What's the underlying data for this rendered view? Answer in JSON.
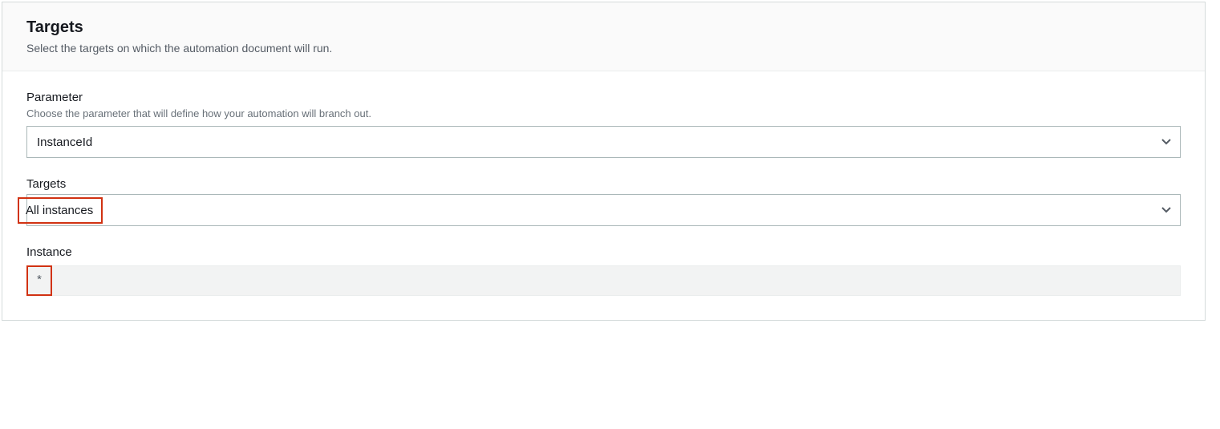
{
  "panel": {
    "title": "Targets",
    "subtitle": "Select the targets on which the automation document will run."
  },
  "parameter": {
    "label": "Parameter",
    "hint": "Choose the parameter that will define how your automation will branch out.",
    "value": "InstanceId"
  },
  "targets": {
    "label": "Targets",
    "value": "All instances"
  },
  "instance": {
    "label": "Instance",
    "value": "*"
  }
}
